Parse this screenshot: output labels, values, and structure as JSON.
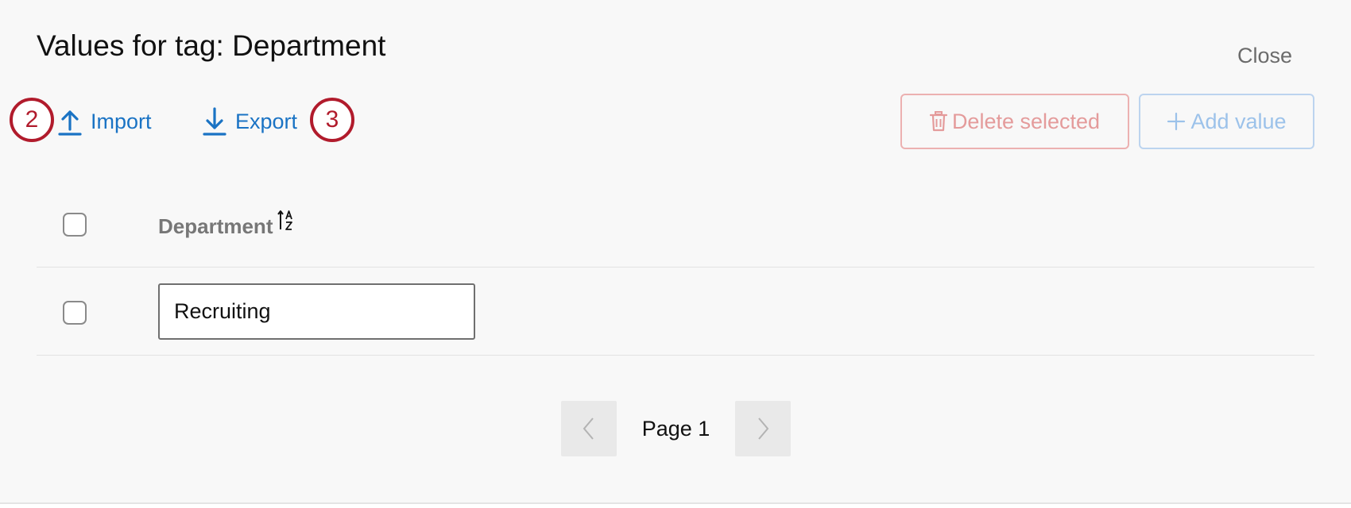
{
  "dialog": {
    "title": "Values for tag: Department",
    "close_label": "Close"
  },
  "callouts": {
    "import_step": "2",
    "export_step": "3"
  },
  "toolbar": {
    "import_label": "Import",
    "import_icon": "upload-icon",
    "export_label": "Export",
    "export_icon": "download-icon",
    "delete_label": "Delete selected",
    "delete_icon": "trash-icon",
    "add_label": "Add value",
    "add_icon": "plus-icon"
  },
  "table": {
    "column_header": "Department",
    "sort_icon": "sort-alpha-icon",
    "rows": [
      {
        "value": "Recruiting",
        "checked": false
      }
    ]
  },
  "pagination": {
    "page_label": "Page 1",
    "prev_icon": "chevron-left-icon",
    "next_icon": "chevron-right-icon"
  },
  "colors": {
    "link": "#1a73c4",
    "callout": "#b11b2c",
    "delete_disabled": "#e49b9b",
    "add_disabled": "#9cc2ea"
  }
}
